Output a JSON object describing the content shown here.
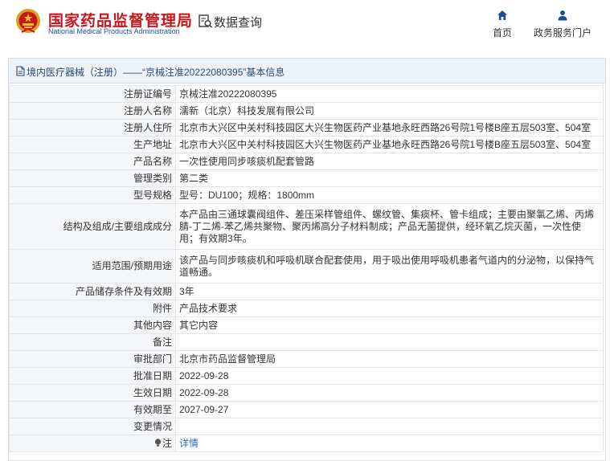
{
  "header": {
    "org_cn": "国家药品监督管理局",
    "org_en": "National Medical Products Administration",
    "query_label": "数据查询",
    "nav": [
      {
        "label": "首页",
        "icon": "home-icon"
      },
      {
        "label": "政务服务门户",
        "icon": "user-icon"
      }
    ]
  },
  "colors": {
    "brand_red": "#c8161d",
    "brand_blue": "#1a4e9c",
    "link_blue": "#1e6ec8"
  },
  "panel": {
    "title": "境内医疗器械（注册）——“京械注准20222080395”基本信息"
  },
  "rows": [
    {
      "label": "注册证编号",
      "value": "京械注准20222080395"
    },
    {
      "label": "注册人名称",
      "value": "濡新（北京）科技发展有限公司"
    },
    {
      "label": "注册人住所",
      "value": "北京市大兴区中关村科技园区大兴生物医药产业基地永旺西路26号院1号楼B座五层503室、504室"
    },
    {
      "label": "生产地址",
      "value": "北京市大兴区中关村科技园区大兴生物医药产业基地永旺西路26号院1号楼B座五层503室、504室"
    },
    {
      "label": "产品名称",
      "value": "一次性使用同步咳痰机配套管路"
    },
    {
      "label": "管理类别",
      "value": "第二类"
    },
    {
      "label": "型号规格",
      "value": "型号：DU100；规格：1800mm"
    },
    {
      "label": "结构及组成/主要组成成分",
      "value": "本产品由三通球囊阀组件、差压采样管组件、螺纹管、集痰杯、管卡组成；主要由聚氯乙烯、丙烯腈-丁二烯-苯乙烯共聚物、聚丙烯高分子材料制成；产品无菌提供，经环氧乙烷灭菌，一次性使用；有效期3年。"
    },
    {
      "label": "适用范围/预期用途",
      "value": "该产品与同步咳痰机和呼吸机联合配套使用，用于吸出使用呼吸机患者气道内的分泌物，以保持气道畅通。"
    },
    {
      "label": "产品储存条件及有效期",
      "value": "3年"
    },
    {
      "label": "附件",
      "value": "产品技术要求"
    },
    {
      "label": "其他内容",
      "value": "其它内容"
    },
    {
      "label": "备注",
      "value": ""
    },
    {
      "label": "审批部门",
      "value": "北京市药品监督管理局"
    },
    {
      "label": "批准日期",
      "value": "2022-09-28"
    },
    {
      "label": "生效日期",
      "value": "2022-09-28"
    },
    {
      "label": "有效期至",
      "value": "2027-09-27"
    },
    {
      "label": "变更情况",
      "value": ""
    }
  ],
  "note_row": {
    "label": "注",
    "link": "详情",
    "icon": "lightbulb-icon"
  }
}
